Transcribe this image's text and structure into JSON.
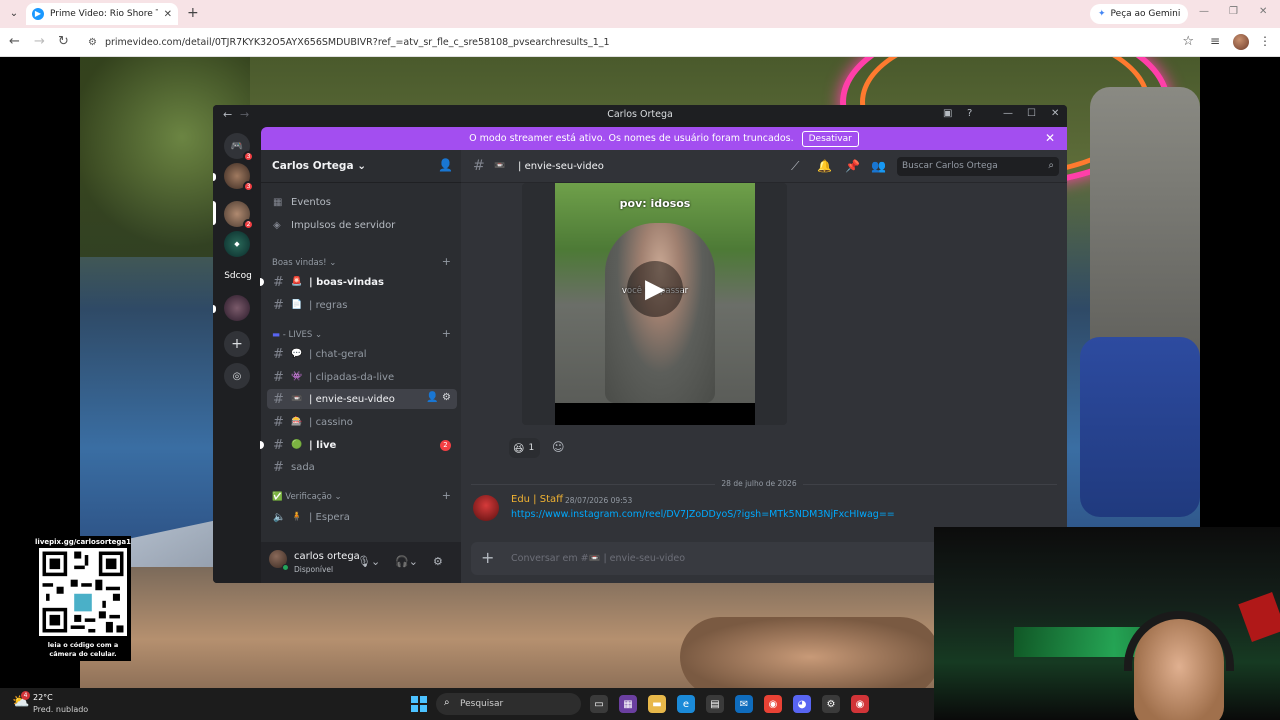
{
  "browser": {
    "tab_title": "Prime Video: Rio Shore Tempor",
    "new_tab": "+",
    "gemini_label": "Peça ao Gemini",
    "url": "primevideo.com/detail/0TJR7KYK32O5AYX656SMDUBIVR?ref_=atv_sr_fle_c_sre58108_pvsearchresults_1_1"
  },
  "discord": {
    "window_title": "Carlos Ortega",
    "banner": {
      "text": "O modo streamer está ativo. Os nomes de usuário foram truncados.",
      "button": "Desativar"
    },
    "guilds": {
      "badge_1": "3",
      "badge_2": "3",
      "badge_3": "2",
      "label": "Sdcog"
    },
    "server_name": "Carlos Ortega",
    "sidebar": {
      "events": "Eventos",
      "boosts": "Impulsos de servidor",
      "cat_welcome": "Boas vindas!",
      "cat_lives": "- LIVES",
      "cat_verify": "Verificação",
      "channels": [
        {
          "name": "boas-vindas",
          "emoji": "🚨"
        },
        {
          "name": "regras",
          "emoji": "📄"
        },
        {
          "name": "chat-geral",
          "emoji": "💬"
        },
        {
          "name": "clipadas-da-live",
          "emoji": "👾"
        },
        {
          "name": "envie-seu-video",
          "emoji": "📼"
        },
        {
          "name": "cassino",
          "emoji": "🎰"
        },
        {
          "name": "live",
          "emoji": "🟢",
          "badge": "2"
        },
        {
          "name": "sada",
          "emoji": ""
        },
        {
          "name": "| Espera",
          "emoji": "🧍"
        }
      ]
    },
    "user": {
      "name": "carlos ortega",
      "status": "Disponível"
    },
    "chat": {
      "channel": "envie-seu-video",
      "search_placeholder": "Buscar Carlos Ortega",
      "video_caption": "pov: idosos",
      "video_caption2": "você vai passar",
      "reaction_emoji": "😆",
      "reaction_count": "1",
      "date_divider": "28 de julho de 2026",
      "message": {
        "author": "Edu | Staff",
        "time": "28/07/2026 09:53",
        "link": "https://www.instagram.com/reel/DV7JZoDDyoS/?igsh=MTk5NDM3NjFxcHIwag=="
      },
      "composer_placeholder": "Conversar em #📼 | envie-seu-video"
    }
  },
  "overlay": {
    "qr_top": "livepix.gg/carlosortega1",
    "qr_bottom_1": "leia o código com a",
    "qr_bottom_2": "câmera do celular."
  },
  "taskbar": {
    "temp": "22°C",
    "weather": "Pred. nublado",
    "weather_badge": "4",
    "search": "Pesquisar"
  },
  "colors": {
    "banner": "#a34ef0",
    "link": "#00a8fc",
    "staff": "#f0b232",
    "badge": "#f23f43"
  }
}
